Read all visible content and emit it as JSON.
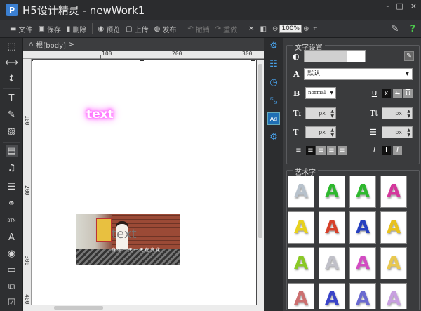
{
  "window": {
    "title": "H5设计精灵 - newWork1",
    "icon": "app-logo-icon",
    "controls": [
      "-",
      "□",
      "×"
    ]
  },
  "toolbar": {
    "items": [
      {
        "label": "文件",
        "icon": "folder-icon"
      },
      {
        "label": "保存",
        "icon": "save-icon"
      },
      {
        "label": "删除",
        "icon": "trash-icon"
      },
      {
        "label": "预览",
        "icon": "eye-icon"
      },
      {
        "label": "上传",
        "icon": "upload-icon"
      },
      {
        "label": "发布",
        "icon": "globe-icon"
      },
      {
        "label": "撤销",
        "icon": "undo-icon"
      },
      {
        "label": "重做",
        "icon": "redo-icon"
      }
    ],
    "zoom": "100%"
  },
  "breadcrumb": {
    "root": "根[body]",
    "sep": ">"
  },
  "ruler": {
    "top": [
      "100",
      "200",
      "300"
    ],
    "left": [
      "100",
      "200",
      "300",
      "400"
    ]
  },
  "canvas": {
    "glow_text": "text",
    "photo_text": "text",
    "photo_subtitle": "身 体 一 天 一 天 在 变 化"
  },
  "panel": {
    "text_settings_title": "文字设置",
    "font": "默认",
    "weight": "normal",
    "unit": "px",
    "styles": {
      "u1": "U",
      "x": "X",
      "s": "S",
      "u2": "U",
      "i1": "I",
      "i2": "I",
      "i3": "I"
    },
    "art_title": "艺术字",
    "art_letter": "A",
    "art_colors": [
      "#b8c2cc",
      "#2eb82e",
      "#2eb82e",
      "#d4379c",
      "#e8d21d",
      "#d6402a",
      "#2640c0",
      "#e8c21d",
      "#8ac926",
      "#c0c0c8",
      "#d24cc2",
      "#e8c850",
      "#cc7070",
      "#3a44c8",
      "#6a6ad0",
      "#c8a0e0"
    ]
  },
  "accent": "#48a0e8"
}
